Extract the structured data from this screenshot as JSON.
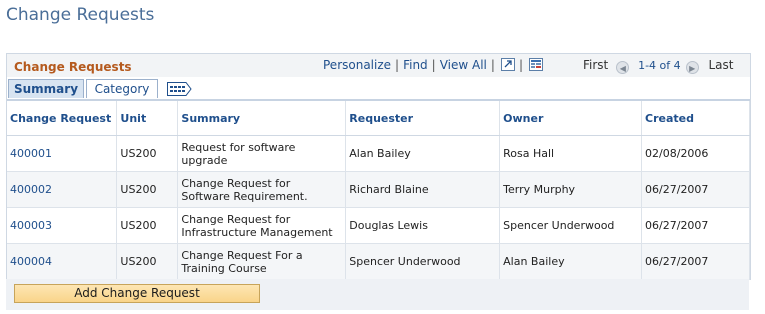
{
  "page": {
    "title": "Change Requests"
  },
  "grid": {
    "title": "Change Requests",
    "toolbar": {
      "personalize": "Personalize",
      "find": "Find",
      "view_all": "View All",
      "sep": "|"
    },
    "nav": {
      "first": "First",
      "count": "1-4 of 4",
      "last": "Last"
    },
    "tabs": [
      {
        "label": "Summary"
      },
      {
        "label": "Category"
      }
    ],
    "columns": [
      "Change Request",
      "Unit",
      "Summary",
      "Requester",
      "Owner",
      "Created"
    ],
    "rows": [
      {
        "id": "400001",
        "unit": "US200",
        "summary_l1": "Request for software",
        "summary_l2": "upgrade",
        "requester": "Alan Bailey",
        "owner": "Rosa Hall",
        "created": "02/08/2006"
      },
      {
        "id": "400002",
        "unit": "US200",
        "summary_l1": "Change Request for",
        "summary_l2": "Software Requirement.",
        "requester": "Richard Blaine",
        "owner": "Terry Murphy",
        "created": "06/27/2007"
      },
      {
        "id": "400003",
        "unit": "US200",
        "summary_l1": "Change Request for",
        "summary_l2": "Infrastructure Management",
        "requester": "Douglas Lewis",
        "owner": "Spencer Underwood",
        "created": "06/27/2007"
      },
      {
        "id": "400004",
        "unit": "US200",
        "summary_l1": "Change Request For a",
        "summary_l2": "Training Course",
        "requester": "Spencer Underwood",
        "owner": "Alan Bailey",
        "created": "06/27/2007"
      }
    ]
  },
  "footer": {
    "add_button": "Add Change Request"
  },
  "icons": [
    "zoom-grid-icon",
    "download-icon",
    "prev-arrow-icon",
    "next-arrow-icon",
    "show-all-columns-icon"
  ],
  "colors": {
    "accent": "#1f4f8c",
    "grid_title": "#b55a1e",
    "page_title": "#4a6e98",
    "button": "#f9d48a"
  }
}
